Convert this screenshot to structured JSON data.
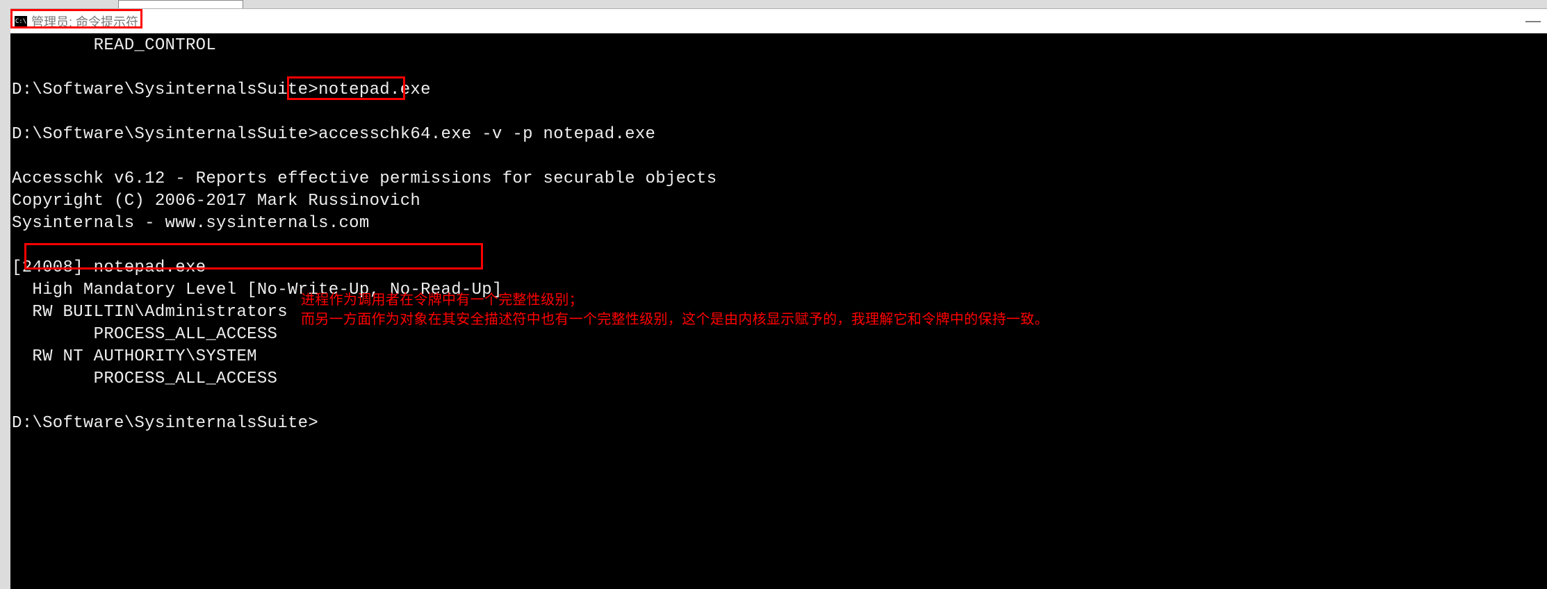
{
  "window": {
    "icon_label": "C:\\",
    "title": "管理员: 命令提示符"
  },
  "terminal": {
    "line01": "        READ_CONTROL",
    "blank1": "",
    "line02a": "D:\\Software\\SysinternalsSuite>",
    "line02b": "notepad.exe",
    "blank2": "",
    "line03": "D:\\Software\\SysinternalsSuite>accesschk64.exe -v -p notepad.exe",
    "blank3": "",
    "line04": "Accesschk v6.12 - Reports effective permissions for securable objects",
    "line05": "Copyright (C) 2006-2017 Mark Russinovich",
    "line06": "Sysinternals - www.sysinternals.com",
    "blank4": "",
    "line07": "[24008] notepad.exe",
    "line08": "  High Mandatory Level [No-Write-Up, No-Read-Up]",
    "line09": "  RW BUILTIN\\Administrators",
    "line10": "        PROCESS_ALL_ACCESS",
    "line11": "  RW NT AUTHORITY\\SYSTEM",
    "line12": "        PROCESS_ALL_ACCESS",
    "blank5": "",
    "line13": "D:\\Software\\SysinternalsSuite>"
  },
  "annotations": {
    "line1": "进程作为调用者在令牌中有一个完整性级别；",
    "line2": "而另一方面作为对象在其安全描述符中也有一个完整性级别，这个是由内核显示赋予的，我理解它和令牌中的保持一致。"
  },
  "controls": {
    "minimize": "—"
  }
}
